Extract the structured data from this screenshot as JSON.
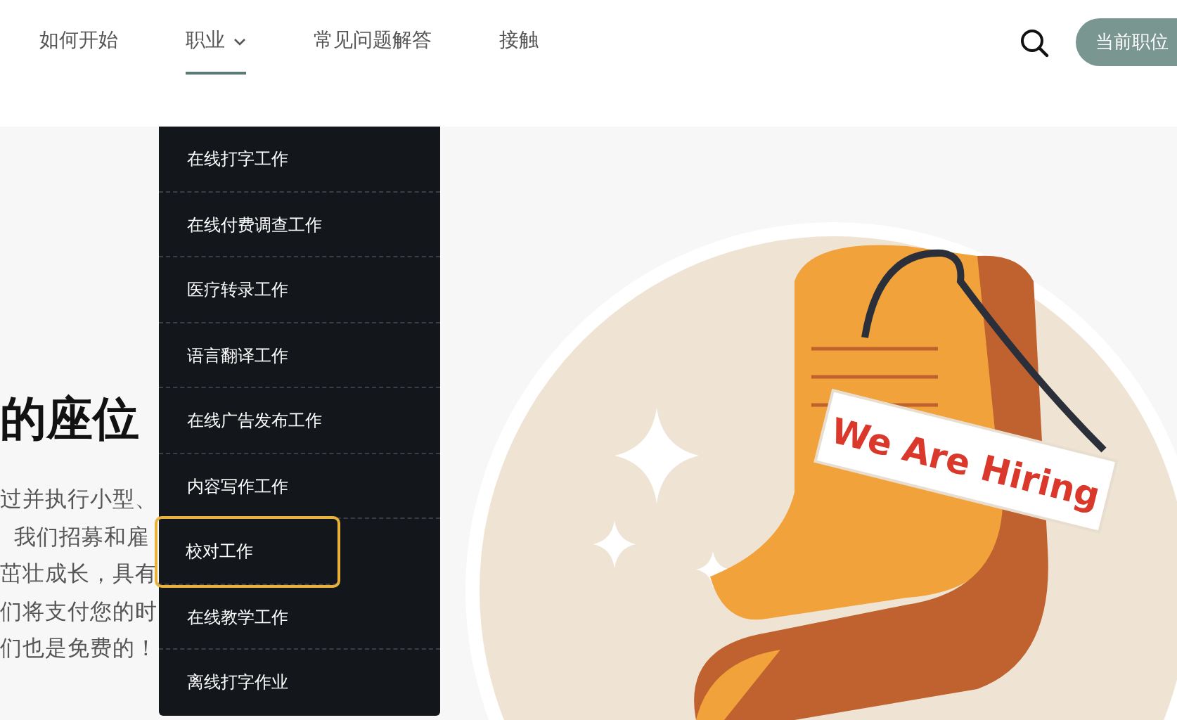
{
  "nav": {
    "items": [
      {
        "label": "如何开始",
        "selected": false,
        "has_menu": false
      },
      {
        "label": "职业",
        "selected": true,
        "has_menu": true
      },
      {
        "label": "常见问题解答",
        "selected": false,
        "has_menu": false
      },
      {
        "label": "接触",
        "selected": false,
        "has_menu": false
      }
    ],
    "button": "当前职位"
  },
  "dropdown": {
    "items": [
      {
        "label": "在线打字工作",
        "selected": false
      },
      {
        "label": "在线付费调查工作",
        "selected": false
      },
      {
        "label": "医疗转录工作",
        "selected": false
      },
      {
        "label": "语言翻译工作",
        "selected": false
      },
      {
        "label": "在线广告发布工作",
        "selected": false
      },
      {
        "label": "内容写作工作",
        "selected": false
      },
      {
        "label": "校对工作",
        "selected": true
      },
      {
        "label": "在线教学工作",
        "selected": false
      },
      {
        "label": "离线打字作业",
        "selected": false
      }
    ]
  },
  "hero": {
    "heading": "的座位",
    "paragraph_lines": [
      "过并执行小型、",
      "  我们招募和雇",
      "茁壮成长，具有",
      "们将支付您的时",
      "们也是免费的！"
    ],
    "sign": "We Are Hiring"
  }
}
